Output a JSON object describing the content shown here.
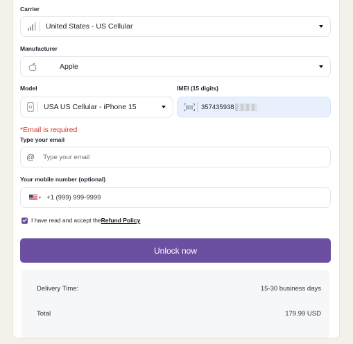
{
  "carrier": {
    "label": "Carrier",
    "value": "United States - US Cellular",
    "icon": "signal-bars-icon"
  },
  "manufacturer": {
    "label": "Manufacturer",
    "value": "Apple",
    "icon": "apple-logo-icon"
  },
  "model": {
    "label": "Model",
    "value": "USA US Cellular - iPhone 15",
    "icon": "phone-icon"
  },
  "imei": {
    "label": "IMEI (15 digits)",
    "value": "357435938",
    "icon": "barcode-icon",
    "highlight_color": "#e8f0fe"
  },
  "email": {
    "error": "*Email is required",
    "label": "Type your email",
    "placeholder": "Type your email",
    "icon": "at-sign-icon"
  },
  "mobile": {
    "label": "Your mobile number (optional)",
    "placeholder": "+1 (999) 999-9999",
    "flag_icon": "us-flag-icon"
  },
  "consent": {
    "text": "I have read and accept the ",
    "link": "Refund Policy",
    "checked": true
  },
  "unlock_button": {
    "label": "Unlock now",
    "color": "#6b4fa0"
  },
  "summary": {
    "delivery_label": "Delivery Time:",
    "delivery_value": "15-30 business days",
    "total_label": "Total",
    "total_value": "179.99 USD"
  },
  "colors": {
    "accent": "#6b4fa0",
    "error": "#d93025",
    "page_bg": "#f3f1ea"
  }
}
